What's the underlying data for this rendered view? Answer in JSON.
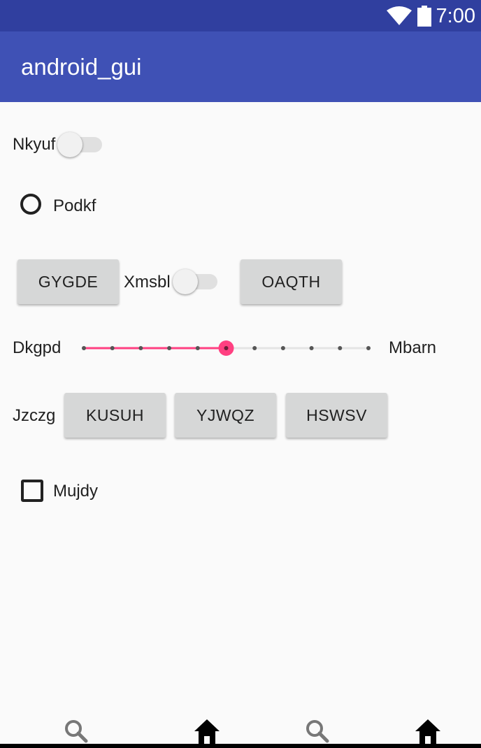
{
  "status_bar": {
    "time": "7:00",
    "wifi_icon": "wifi-icon",
    "battery_icon": "battery-icon"
  },
  "app_bar": {
    "title": "android_gui",
    "color": "#3f51b5",
    "status_color": "#303f9f"
  },
  "form": {
    "switch_1": {
      "label": "Nkyuf",
      "checked": false
    },
    "radio_1": {
      "label": "Podkf",
      "checked": false
    },
    "button_1": {
      "label": "GYGDE"
    },
    "switch_2": {
      "label": "Xmsbl",
      "checked": false
    },
    "button_2": {
      "label": "OAQTH"
    },
    "slider": {
      "label_left": "Dkgpd",
      "label_right": "Mbarn",
      "min": 0,
      "max": 10,
      "value": 5,
      "accent": "#ff4081"
    },
    "button_group": {
      "label": "Jzczg",
      "buttons": [
        "KUSUH",
        "YJWQZ",
        "HSWSV"
      ]
    },
    "checkbox_1": {
      "label": "Mujdy",
      "checked": false
    }
  },
  "bottom_nav": {
    "items": [
      "search-icon",
      "home-icon",
      "search-icon",
      "home-icon"
    ]
  }
}
